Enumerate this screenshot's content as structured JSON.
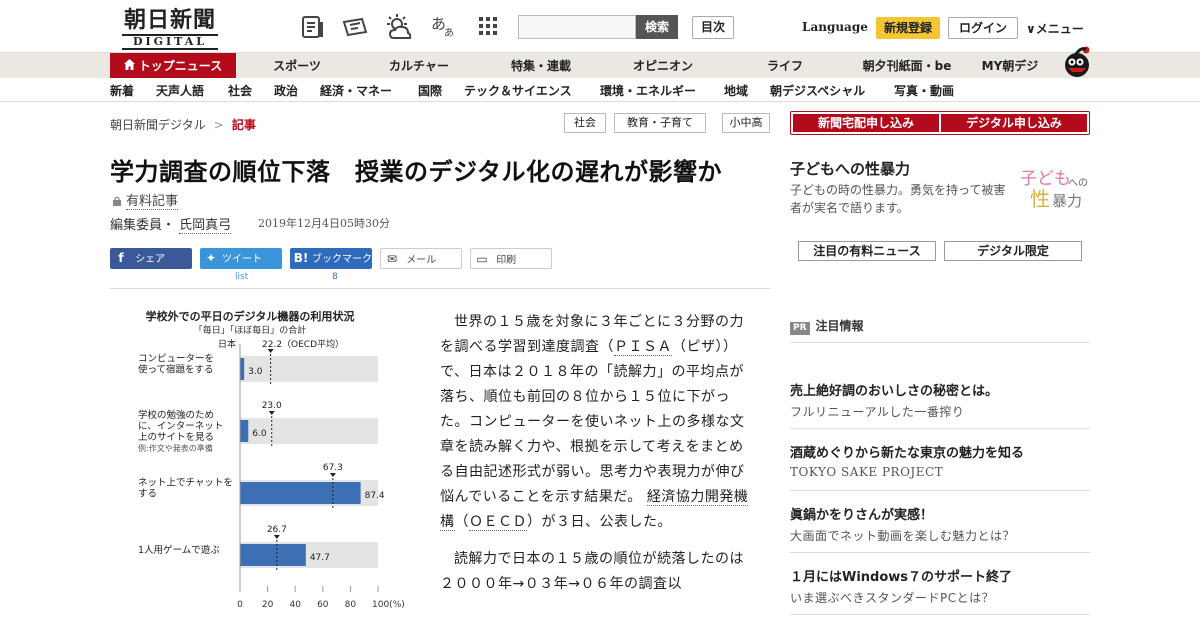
{
  "header": {
    "logo_main": "朝日新聞",
    "logo_sub": "DIGITAL",
    "search_label": "検索",
    "toc_label": "目次",
    "language_label": "Language",
    "signup_label": "新規登録",
    "login_label": "ログイン",
    "menu_label": "∨メニュー"
  },
  "nav_primary": [
    "トップニュース",
    "スポーツ",
    "カルチャー",
    "特集・連載",
    "オピニオン",
    "ライフ",
    "朝夕刊紙面・be",
    "MY朝デジ"
  ],
  "nav_secondary": [
    "新着",
    "天声人語",
    "社会",
    "政治",
    "経済・マネー",
    "国際",
    "テック＆サイエンス",
    "環境・エネルギー",
    "地域",
    "朝デジスペシャル",
    "写真・動画"
  ],
  "breadcrumb": {
    "home": "朝日新聞デジタル",
    "sep": ">",
    "current": "記事"
  },
  "tags": [
    "社会",
    "教育・子育て",
    "小中高"
  ],
  "article": {
    "title": "学力調査の順位下落　授業のデジタル化の遅れが影響か",
    "paid_label": "有料記事",
    "author_prefix": "編集委員・",
    "author_name": "氏岡真弓",
    "date": "2019年12月4日05時30分",
    "paragraph1_a": "世界の１５歳を対象に３年ごとに３分野の力を調べる学習到達度調査（",
    "paragraph1_pisa": "ＰＩＳＡ",
    "paragraph1_b": "（ピザ））で、日本は２０１８年の「読解力」の平均点が落ち、順位も前回の８位から１５位に下がった。コンピューターを使いネット上の多様な文章を読み解く力や、根拠を示して考えをまとめる自由記述形式が弱い。思考力や表現力が伸び悩んでいることを示す結果だ。",
    "paragraph1_oecd": "経済協力開発機構",
    "paragraph1_c": "（",
    "paragraph1_oecd2": "ＯＥＣＤ",
    "paragraph1_d": "）が３日、公表した。",
    "paragraph2": "読解力で日本の１５歳の順位が続落したのは２０００年→０３年→０６年の調査以"
  },
  "share": {
    "facebook": "シェア",
    "twitter": "ツイート",
    "twitter_count": "list",
    "hatena": "ブックマーク",
    "hatena_count": "8",
    "mail": "メール",
    "print": "印刷",
    "hatena_icon": "B!"
  },
  "chart_data": {
    "type": "bar",
    "title": "学校外での平日のデジタル機器の利用状況",
    "subtitle": "「毎日」「ほぼ毎日」の合計",
    "series": [
      {
        "name": "日本",
        "values": [
          3.0,
          6.0,
          87.4,
          47.7
        ]
      },
      {
        "name": "OECD平均",
        "values": [
          22.2,
          23.0,
          67.3,
          26.7
        ]
      }
    ],
    "oecd_header": "22.2（OECD平均）",
    "categories": [
      "コンピューターを使って宿題をする",
      "学校の勉強のために、インターネット上のサイトを見る",
      "ネット上でチャットをする",
      "1人用ゲームで遊ぶ"
    ],
    "category_lines": [
      [
        "コンピューターを",
        "使って宿題をする"
      ],
      [
        "学校の勉強のため",
        "に、インターネット",
        "上のサイトを見る"
      ],
      [
        "ネット上でチャットを",
        "する"
      ],
      [
        "1人用ゲームで遊ぶ"
      ]
    ],
    "category_note": "例:作文や発表の準備",
    "xlim": [
      0,
      100
    ],
    "xticks": [
      "0",
      "20",
      "40",
      "60",
      "80",
      "100(%)"
    ],
    "colors": {
      "japan": "#3d6fb5",
      "track": "#e4e4e4"
    }
  },
  "sidebar": {
    "btn_home": "新聞宅配申し込み",
    "btn_digital": "デジタル申し込み",
    "feature_title": "子どもへの性暴力",
    "feature_desc": "子どもの時の性暴力。勇気を持って被害者が実名で語ります。",
    "feature_logo_a": "子ども",
    "feature_logo_b": "への",
    "feature_logo_c": "性",
    "feature_logo_d": "暴力",
    "tab_paid": "注目の有料ニュース",
    "tab_digital": "デジタル限定",
    "pr_badge": "PR",
    "pr_header": "注目情報",
    "pr_items": [
      {
        "title": "売上絶好調のおいしさの秘密とは。",
        "sub": "フルリニューアルした一番搾り"
      },
      {
        "title": "酒蔵めぐりから新たな東京の魅力を知る",
        "sub": "TOKYO SAKE PROJECT"
      },
      {
        "title": "眞鍋かをりさんが実感！",
        "sub": "大画面でネット動画を楽しむ魅力とは？"
      },
      {
        "title": "１月にはWindows７のサポート終了",
        "sub": "いま選ぶべきスタンダードPCとは？"
      }
    ]
  }
}
